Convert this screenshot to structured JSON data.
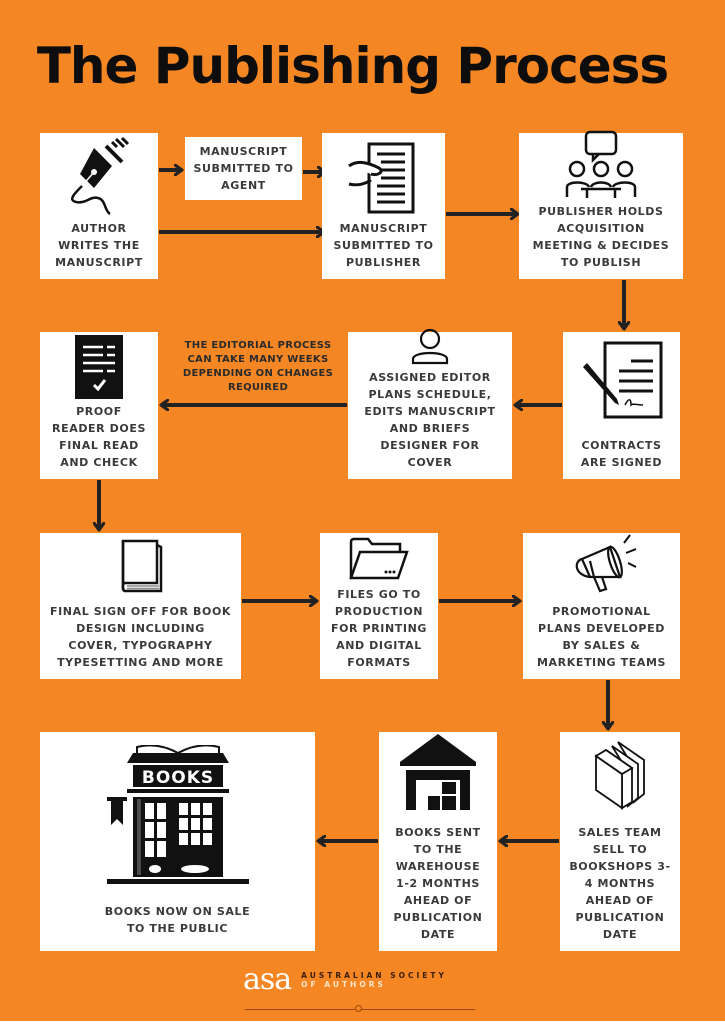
{
  "title": "The Publishing Process",
  "colors": {
    "background": "#f58624",
    "box": "#ffffff",
    "text": "#3a3a3a",
    "arrow": "#222222"
  },
  "steps": [
    {
      "id": "author",
      "icon": "fountain-pen-icon",
      "label": "AUTHOR\nWRITES THE\nMANUSCRIPT"
    },
    {
      "id": "agent",
      "icon": null,
      "label": "MANUSCRIPT\nSUBMITTED TO\nAGENT"
    },
    {
      "id": "publisher-submit",
      "icon": "document-hand-icon",
      "label": "MANUSCRIPT\nSUBMITTED TO\nPUBLISHER"
    },
    {
      "id": "acquisition",
      "icon": "meeting-icon",
      "label": "PUBLISHER HOLDS\nACQUISITION\nMEETING & DECIDES\nTO PUBLISH"
    },
    {
      "id": "contracts",
      "icon": "contract-pen-icon",
      "label": "CONTRACTS\nARE SIGNED"
    },
    {
      "id": "editor",
      "icon": "user-icon",
      "label": "ASSIGNED EDITOR\nPLANS SCHEDULE,\nEDITS MANUSCRIPT\nAND BRIEFS\nDESIGNER FOR\nCOVER"
    },
    {
      "id": "proof",
      "icon": "checked-document-icon",
      "label": "PROOF\nREADER DOES\nFINAL READ\nAND CHECK"
    },
    {
      "id": "signoff",
      "icon": "book-icon",
      "label": "FINAL SIGN OFF FOR BOOK\nDESIGN INCLUDING\nCOVER, TYPOGRAPHY\nTYPESETTING AND MORE"
    },
    {
      "id": "production",
      "icon": "folder-icon",
      "label": "FILES GO TO\nPRODUCTION\nFOR PRINTING\nAND DIGITAL\nFORMATS"
    },
    {
      "id": "promotional",
      "icon": "megaphone-icon",
      "label": "PROMOTIONAL\nPLANS DEVELOPED\nBY SALES &\nMARKETING TEAMS"
    },
    {
      "id": "sales",
      "icon": "books-stack-icon",
      "label": "SALES TEAM\nSELL TO\nBOOKSHOPS 3-\n4 MONTHS\nAHEAD OF\nPUBLICATION\nDATE"
    },
    {
      "id": "warehouse",
      "icon": "warehouse-icon",
      "label": "BOOKS SENT\nTO THE\nWAREHOUSE\n1-2 MONTHS\nAHEAD OF\nPUBLICATION\nDATE"
    },
    {
      "id": "on-sale",
      "icon": "bookshop-icon",
      "label": "BOOKS NOW ON SALE\nTO THE PUBLIC"
    }
  ],
  "notes": {
    "editorial": "THE EDITORIAL PROCESS\nCAN TAKE MANY WEEKS\nDEPENDING ON CHANGES\nREQUIRED"
  },
  "bookshop_sign": "BOOKS",
  "footer": {
    "logo": "asa",
    "org_line1": "AUSTRALIAN SOCIETY",
    "org_line2": "OF AUTHORS"
  }
}
